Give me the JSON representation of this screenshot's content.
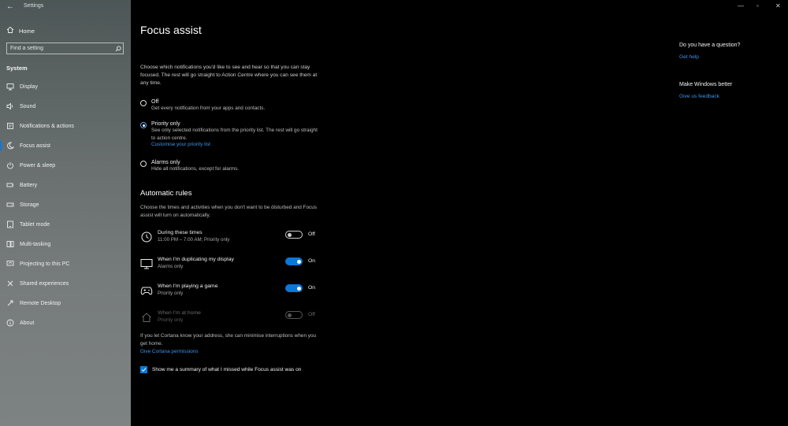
{
  "window": {
    "app_title": "Settings",
    "back_label": "←",
    "minimize_label": "—",
    "maximize_label": "▫",
    "close_label": "✕"
  },
  "sidebar": {
    "home_label": "Home",
    "search_placeholder": "Find a setting",
    "section_label": "System",
    "items": [
      {
        "label": "Display",
        "icon": "display-icon"
      },
      {
        "label": "Sound",
        "icon": "sound-icon"
      },
      {
        "label": "Notifications & actions",
        "icon": "notifications-icon"
      },
      {
        "label": "Focus assist",
        "icon": "moon-icon",
        "active": true
      },
      {
        "label": "Power & sleep",
        "icon": "power-icon"
      },
      {
        "label": "Battery",
        "icon": "battery-icon"
      },
      {
        "label": "Storage",
        "icon": "storage-icon"
      },
      {
        "label": "Tablet mode",
        "icon": "tablet-icon"
      },
      {
        "label": "Multi-tasking",
        "icon": "multitasking-icon"
      },
      {
        "label": "Projecting to this PC",
        "icon": "projecting-icon"
      },
      {
        "label": "Shared experiences",
        "icon": "shared-icon"
      },
      {
        "label": "Remote Desktop",
        "icon": "remote-desktop-icon"
      },
      {
        "label": "About",
        "icon": "info-icon"
      }
    ]
  },
  "main": {
    "title": "Focus assist",
    "intro": "Choose which notifications you'd like to see and hear so that you can stay focused. The rest will go straight to Action Centre where you can see them at any time.",
    "options": [
      {
        "label": "Off",
        "desc": "Get every notification from your apps and contacts.",
        "selected": false
      },
      {
        "label": "Priority only",
        "desc": "See only selected notifications from the priority list. The rest will go straight to action centre.",
        "link": "Customise your priority list",
        "selected": true
      },
      {
        "label": "Alarms only",
        "desc": "Hide all notifications, except for alarms.",
        "selected": false
      }
    ],
    "automatic_rules": {
      "title": "Automatic rules",
      "desc": "Choose the times and activities when you don't want to be disturbed and Focus assist will turn on automatically.",
      "rules": [
        {
          "title": "During these times",
          "sub": "11:00 PM – 7:00 AM; Priority only",
          "state": "Off",
          "on": false,
          "icon": "clock-icon"
        },
        {
          "title": "When I'm duplicating my display",
          "sub": "Alarms only",
          "state": "On",
          "on": true,
          "icon": "monitor-icon"
        },
        {
          "title": "When I'm playing a game",
          "sub": "Priority only",
          "state": "On",
          "on": true,
          "icon": "gamepad-icon"
        },
        {
          "title": "When I'm at home",
          "sub": "Priority only",
          "state": "Off",
          "on": false,
          "disabled": true,
          "icon": "house-icon"
        }
      ],
      "cortana_text": "If you let Cortana know your address, she can minimise interruptions when you get home.",
      "cortana_link": "Give Cortana permissions"
    },
    "summary_checkbox_label": "Show me a summary of what I missed while Focus assist was on",
    "summary_checked": true
  },
  "right_panel": {
    "question_heading": "Do you have a question?",
    "help_link": "Get help",
    "better_heading": "Make Windows better",
    "feedback_link": "Give us feedback"
  },
  "colors": {
    "accent": "#0a78d7",
    "link": "#3d95e8"
  }
}
